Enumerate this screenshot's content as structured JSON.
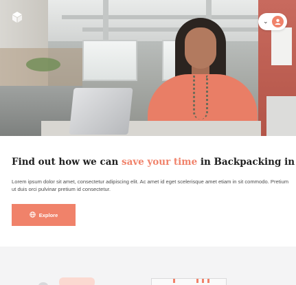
{
  "header": {
    "logo_icon": "cube-icon",
    "user_menu": {
      "chevron_icon": "chevron-down-icon",
      "avatar_icon": "user-icon",
      "accent": "#f0826a"
    }
  },
  "hero": {
    "image_description_icon": "hero-photo"
  },
  "content": {
    "headline_before": "Find out how we can ",
    "headline_accent": "save your time",
    "headline_after": " in Backpacking in Europe",
    "body": "Lorem ipsum dolor sit amet, consectetur adipiscing elit. Ac amet id eget scelerisque amet etiam in sit commodo. Pretium ut duis orci pulvinar pretium id consectetur.",
    "explore_button": {
      "label": "Explore",
      "icon": "globe-icon"
    }
  },
  "colors": {
    "accent": "#f0826a",
    "text": "#1f1f1f",
    "muted": "#4d4d4d"
  }
}
